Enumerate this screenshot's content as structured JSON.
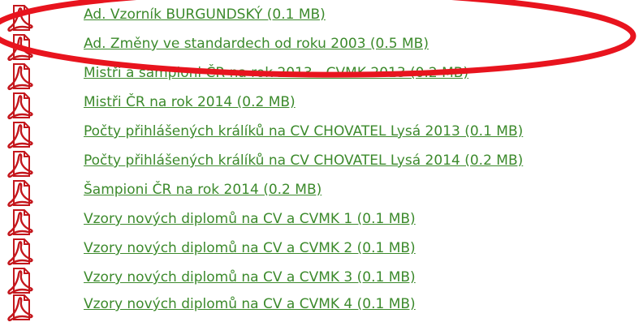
{
  "files": [
    {
      "name": "Ad. Vzorník BURGUNDSKÝ (0.1 MB)",
      "icon": "pdf-icon"
    },
    {
      "name": "Ad. Změny ve standardech od roku 2003 (0.5 MB)",
      "icon": "pdf-icon"
    },
    {
      "name": "Mistři a šampioni ČR na rok 2013 - CVMK 2013 (0.2 MB)",
      "icon": "pdf-icon"
    },
    {
      "name": "Mistři ČR na rok 2014 (0.2 MB)",
      "icon": "pdf-icon"
    },
    {
      "name": "Počty přihlášených králíků na CV CHOVATEL Lysá 2013 (0.1 MB)",
      "icon": "pdf-icon"
    },
    {
      "name": "Počty přihlášených králíků na CV CHOVATEL Lysá 2014 (0.2 MB)",
      "icon": "pdf-icon"
    },
    {
      "name": "Šampioni ČR na rok 2014 (0.2 MB)",
      "icon": "pdf-icon"
    },
    {
      "name": "Vzory nových diplomů na CV a CVMK 1 (0.1 MB)",
      "icon": "pdf-icon"
    },
    {
      "name": "Vzory nových diplomů na CV a CVMK 2 (0.1 MB)",
      "icon": "pdf-icon"
    },
    {
      "name": "Vzory nových diplomů na CV a CVMK 3 (0.1 MB)",
      "icon": "pdf-icon"
    },
    {
      "name": "Vzory nových diplomů na CV a CVMK 4 (0.1 MB)",
      "icon": "pdf-icon"
    }
  ],
  "colors": {
    "link": "#3c8a2c",
    "pdf_icon": "#c4161c",
    "highlight": "#e8141e"
  }
}
